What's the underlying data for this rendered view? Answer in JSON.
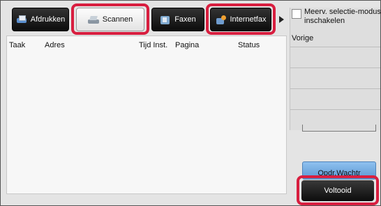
{
  "tabs": {
    "print": "Afdrukken",
    "scan": "Scannen",
    "fax": "Faxen",
    "internetfax": "Internetfax"
  },
  "columns": {
    "job": "Taak",
    "address": "Adres",
    "time": "Tijd Inst.",
    "page": "Pagina",
    "status": "Status"
  },
  "right_panel": {
    "multi_select_label": "Meerv. selectie-modus inschakelen",
    "previous_label": "Vorige",
    "queue_button": "Opdr.Wachtr",
    "complete_button": "Voltooid"
  },
  "colors": {
    "highlight": "#d81e3f",
    "queue_button": "#7fb3e6"
  }
}
